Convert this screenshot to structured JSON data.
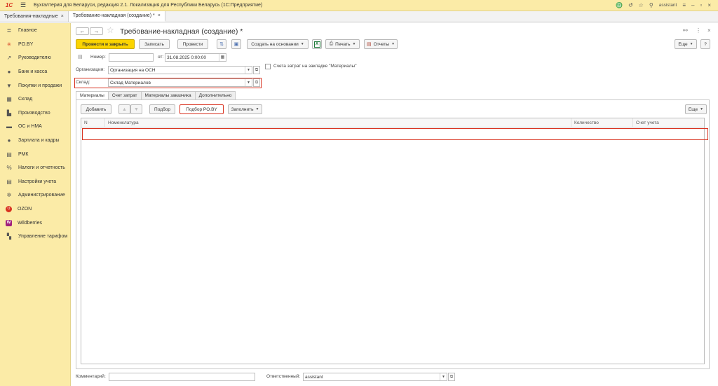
{
  "app": {
    "logo": "1С",
    "title": "Бухгалтерия для Беларуси, редакция 2.1. Локализация для Республики Беларусь   (1С:Предприятие)",
    "user": "assistant"
  },
  "window_tabs": [
    {
      "label": "Требования-накладные"
    },
    {
      "label": "Требование-накладная (создание) *"
    }
  ],
  "sidebar": {
    "items": [
      {
        "label": "Главное",
        "icon": "≣"
      },
      {
        "label": "PO.BY",
        "icon": "✳"
      },
      {
        "label": "Руководителю",
        "icon": "↗"
      },
      {
        "label": "Банк и касса",
        "icon": "●"
      },
      {
        "label": "Покупки и продажи",
        "icon": "▼"
      },
      {
        "label": "Склад",
        "icon": "▦"
      },
      {
        "label": "Производство",
        "icon": "▙"
      },
      {
        "label": "ОС и НМА",
        "icon": "▬"
      },
      {
        "label": "Зарплата и кадры",
        "icon": "●"
      },
      {
        "label": "РМК",
        "icon": "▤"
      },
      {
        "label": "Налоги и отчетность",
        "icon": "%"
      },
      {
        "label": "Настройки учета",
        "icon": "▤"
      },
      {
        "label": "Администрирование",
        "icon": "✲"
      },
      {
        "label": "OZON",
        "icon": "O"
      },
      {
        "label": "Wildberries",
        "icon": "W"
      },
      {
        "label": "Управление тарифом",
        "icon": "▚"
      }
    ]
  },
  "form": {
    "title": "Требование-накладная (создание) *",
    "toolbar": {
      "post_close": "Провести и закрыть",
      "save": "Записать",
      "post": "Провести",
      "create_based": "Создать на основании",
      "print": "Печать",
      "reports": "Отчеты",
      "more": "Еще",
      "help": "?"
    },
    "fields": {
      "number_label": "Номер:",
      "number_value": "",
      "date_label": "от:",
      "date_value": "31.08.2025  0:00:00",
      "org_label": "Организация:",
      "org_value": "Организация на ОСН",
      "warehouse_label": "Склад:",
      "warehouse_value": "Склад Материалов",
      "cost_accounts_label": "Счета затрат на закладке \"Материалы\""
    },
    "subtabs": [
      "Материалы",
      "Счет затрат",
      "Материалы заказчика",
      "Дополнительно"
    ],
    "table_toolbar": {
      "add": "Добавить",
      "select": "Подбор",
      "select_po": "Подбор PO.BY",
      "fill": "Заполнить",
      "more": "Еще"
    },
    "table": {
      "columns": [
        "N",
        "Номенклатура",
        "Количество",
        "Счет учета"
      ]
    },
    "footer": {
      "comment_label": "Комментарий:",
      "comment_value": "",
      "responsible_label": "Ответственный:",
      "responsible_value": "assistant"
    }
  }
}
